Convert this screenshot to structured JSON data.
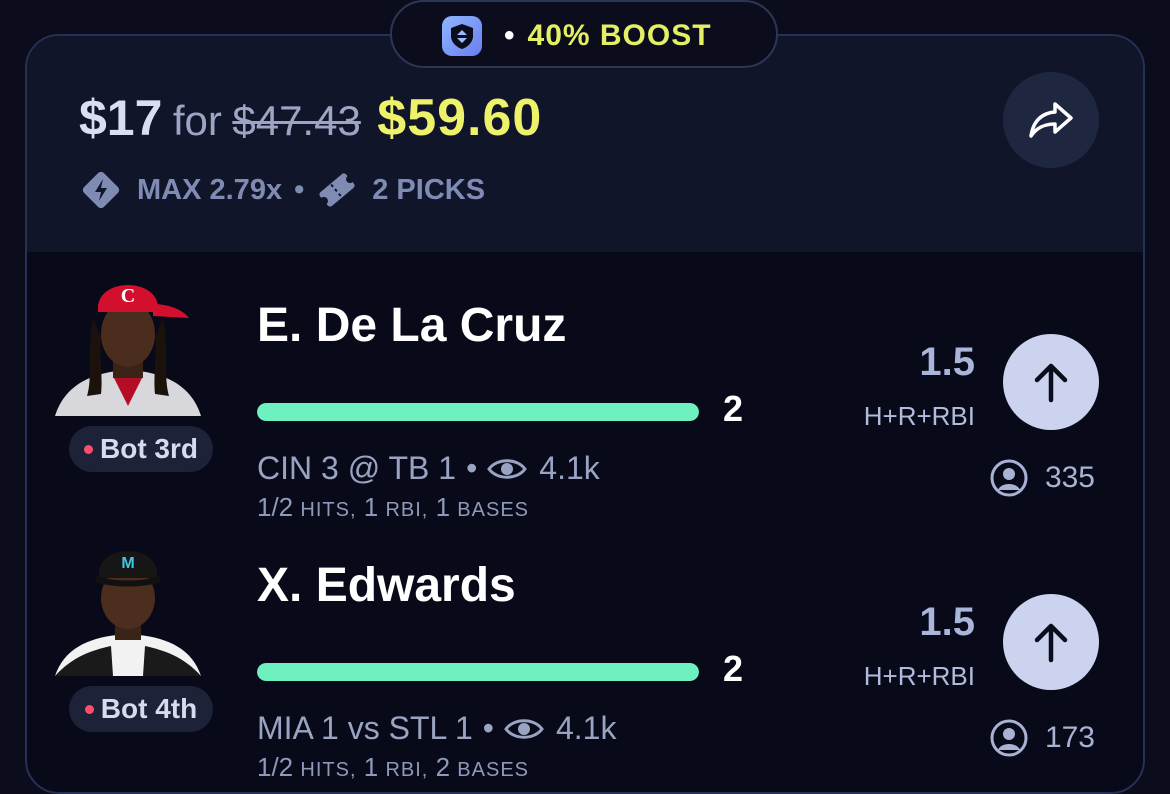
{
  "boost": {
    "label": "40% BOOST",
    "separator": "•",
    "icon": "shield-boost-icon"
  },
  "header": {
    "stake": "$17",
    "for_label": "for",
    "original_payout": "$47.43",
    "boosted_payout": "$59.60",
    "max_multiplier": "MAX 2.79x",
    "separator": "•",
    "picks_count": "2 PICKS",
    "share_icon": "share-icon"
  },
  "picks": [
    {
      "player": "E. De La Cruz",
      "inning": "Bot 3rd",
      "progress_value": "2",
      "progress_fraction": 1.0,
      "game": "CIN 3 @ TB 1",
      "separator": "•",
      "views": "4.1k",
      "stats": {
        "hits_value": "1/2",
        "hits_label": "HITS,",
        "rbi_value": "1",
        "rbi_label": "RBI,",
        "bases_value": "1",
        "bases_label": "BASES"
      },
      "line": "1.5",
      "stat_type": "H+R+RBI",
      "direction_icon": "arrow-up-icon",
      "pick_count": "335",
      "team_color": "#c8102e"
    },
    {
      "player": "X. Edwards",
      "inning": "Bot 4th",
      "progress_value": "2",
      "progress_fraction": 1.0,
      "game": "MIA 1 vs STL 1",
      "separator": "•",
      "views": "4.1k",
      "stats": {
        "hits_value": "1/2",
        "hits_label": "HITS,",
        "rbi_value": "1",
        "rbi_label": "RBI,",
        "bases_value": "2",
        "bases_label": "BASES"
      },
      "line": "1.5",
      "stat_type": "H+R+RBI",
      "direction_icon": "arrow-up-icon",
      "pick_count": "173",
      "team_color": "#1a1a1a"
    }
  ],
  "colors": {
    "accent_yellow": "#eef26a",
    "progress_green": "#6ff0bf",
    "live_dot": "#ff4d6d",
    "background": "#080a19"
  }
}
